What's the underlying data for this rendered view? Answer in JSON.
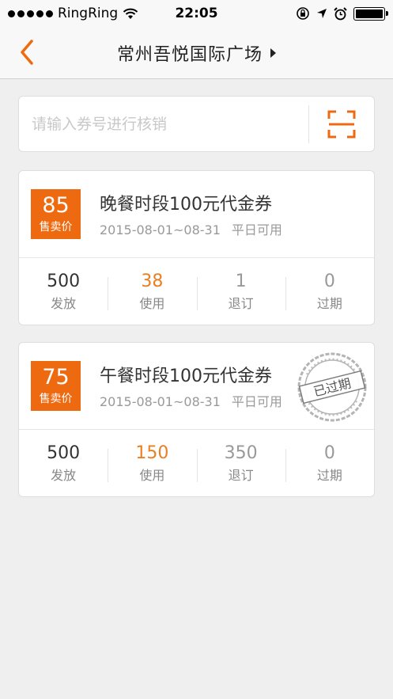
{
  "status_bar": {
    "carrier": "RingRing",
    "time": "22:05"
  },
  "nav": {
    "title": "常州吾悦国际广场"
  },
  "search": {
    "placeholder": "请输入券号进行核销"
  },
  "vouchers": [
    {
      "price": "85",
      "price_label": "售卖价",
      "title": "晚餐时段100元代金券",
      "date_range": "2015-08-01~08-31",
      "availability": "平日可用",
      "expired": false,
      "stats": [
        {
          "value": "500",
          "label": "发放"
        },
        {
          "value": "38",
          "label": "使用"
        },
        {
          "value": "1",
          "label": "退订"
        },
        {
          "value": "0",
          "label": "过期"
        }
      ]
    },
    {
      "price": "75",
      "price_label": "售卖价",
      "title": "午餐时段100元代金券",
      "date_range": "2015-08-01~08-31",
      "availability": "平日可用",
      "expired": true,
      "stamp_text": "已过期",
      "stats": [
        {
          "value": "500",
          "label": "发放"
        },
        {
          "value": "150",
          "label": "使用"
        },
        {
          "value": "350",
          "label": "退订"
        },
        {
          "value": "0",
          "label": "过期"
        }
      ]
    }
  ],
  "colors": {
    "accent": "#ee6a10",
    "used": "#e97f22",
    "background": "#efefef"
  }
}
